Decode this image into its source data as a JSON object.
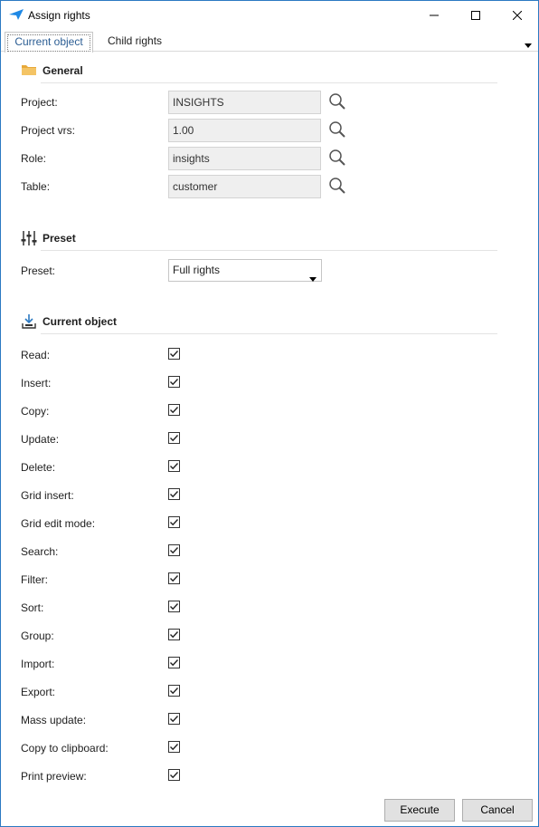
{
  "window": {
    "title": "Assign rights",
    "minimize_icon": "minimize-icon",
    "maximize_icon": "maximize-icon",
    "close_icon": "close-icon"
  },
  "tabs": [
    {
      "label": "Current object",
      "active": true
    },
    {
      "label": "Child rights",
      "active": false
    }
  ],
  "general": {
    "title": "General",
    "icon": "folder-icon",
    "fields": [
      {
        "label": "Project:",
        "value": "INSIGHTS"
      },
      {
        "label": "Project vrs:",
        "value": "1.00"
      },
      {
        "label": "Role:",
        "value": "insights"
      },
      {
        "label": "Table:",
        "value": "customer"
      }
    ]
  },
  "preset": {
    "title": "Preset",
    "icon": "sliders-icon",
    "label": "Preset:",
    "value": "Full rights"
  },
  "current_object": {
    "title": "Current object",
    "icon": "download-tray-icon",
    "rights": [
      {
        "label": "Read:",
        "checked": true
      },
      {
        "label": "Insert:",
        "checked": true
      },
      {
        "label": "Copy:",
        "checked": true
      },
      {
        "label": "Update:",
        "checked": true
      },
      {
        "label": "Delete:",
        "checked": true
      },
      {
        "label": "Grid insert:",
        "checked": true
      },
      {
        "label": "Grid edit mode:",
        "checked": true
      },
      {
        "label": "Search:",
        "checked": true
      },
      {
        "label": "Filter:",
        "checked": true
      },
      {
        "label": "Sort:",
        "checked": true
      },
      {
        "label": "Group:",
        "checked": true
      },
      {
        "label": "Import:",
        "checked": true
      },
      {
        "label": "Export:",
        "checked": true
      },
      {
        "label": "Mass update:",
        "checked": true
      },
      {
        "label": "Copy to clipboard:",
        "checked": true
      },
      {
        "label": "Print preview:",
        "checked": true
      }
    ]
  },
  "buttons": {
    "execute": "Execute",
    "cancel": "Cancel"
  },
  "colors": {
    "window_border": "#2b79c2",
    "active_tab_text": "#2b5d93",
    "app_icon": "#1e88e5",
    "folder": "#e8a93a"
  }
}
